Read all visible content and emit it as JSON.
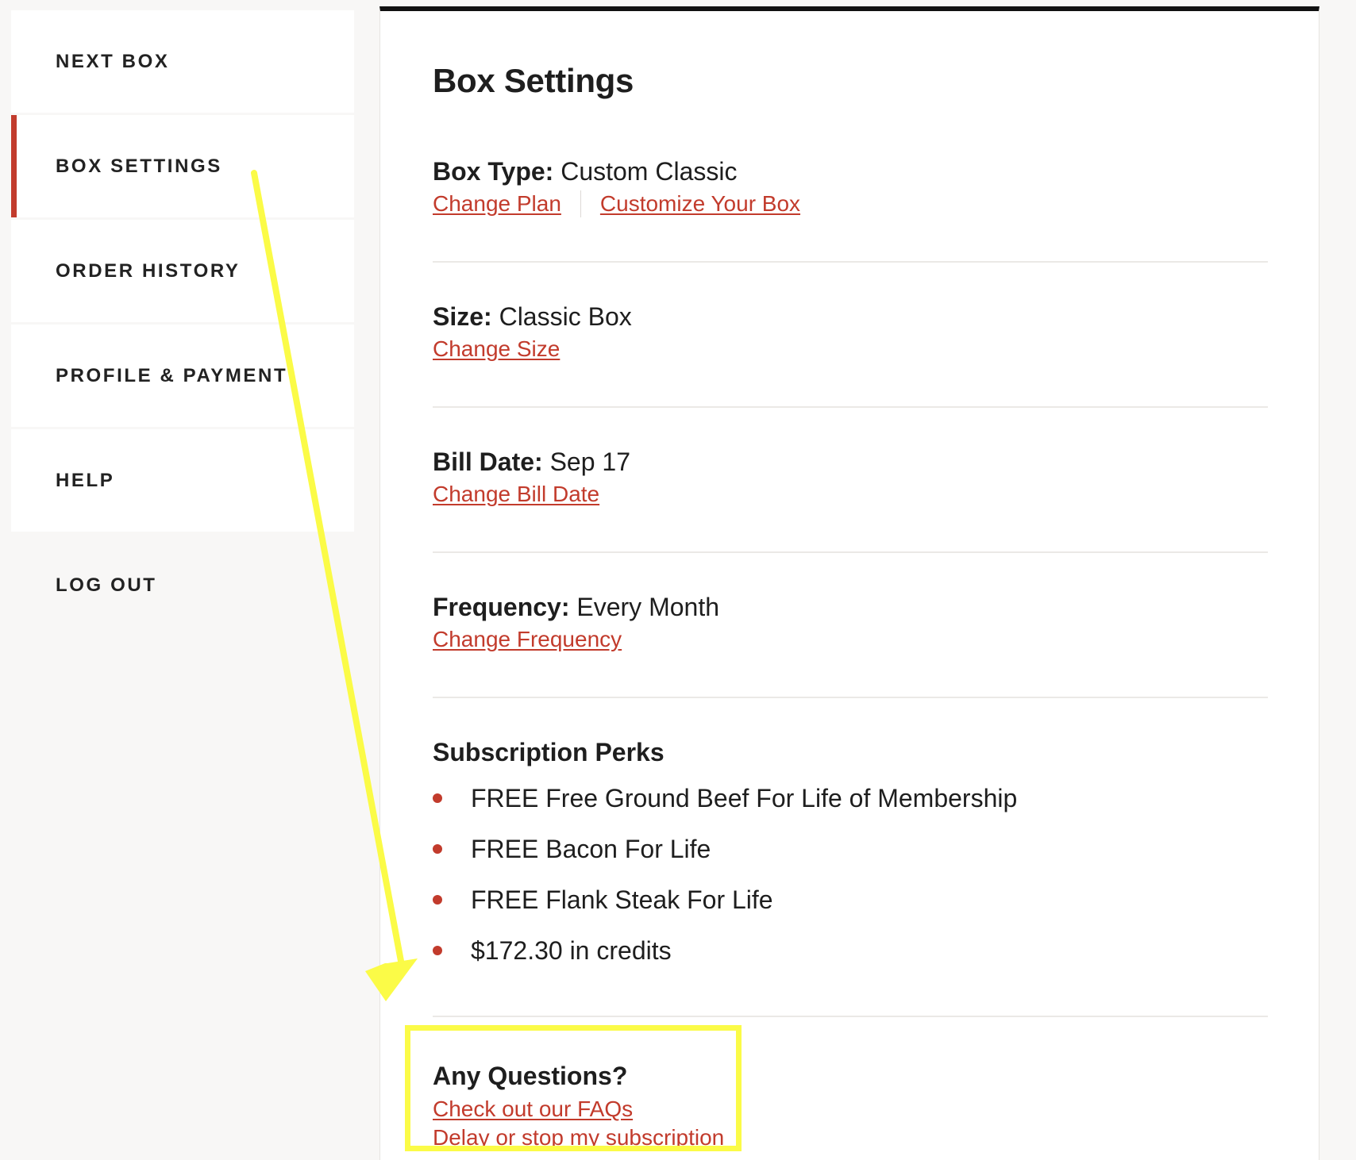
{
  "sidebar": {
    "items": [
      {
        "label": "NEXT BOX"
      },
      {
        "label": "BOX SETTINGS"
      },
      {
        "label": "ORDER HISTORY"
      },
      {
        "label": "PROFILE & PAYMENT"
      },
      {
        "label": "HELP"
      },
      {
        "label": "LOG OUT"
      }
    ],
    "active_index": 1,
    "accent_color": "#c23b2c"
  },
  "main": {
    "title": "Box Settings",
    "box_type": {
      "label": "Box Type:",
      "value": "Custom Classic",
      "links": [
        "Change Plan",
        "Customize Your Box"
      ]
    },
    "size": {
      "label": "Size:",
      "value": "Classic Box",
      "link": "Change Size"
    },
    "bill_date": {
      "label": "Bill Date:",
      "value": "Sep 17",
      "link": "Change Bill Date"
    },
    "frequency": {
      "label": "Frequency:",
      "value": "Every Month",
      "link": "Change Frequency"
    },
    "perks": {
      "title": "Subscription Perks",
      "items": [
        "FREE Free Ground Beef For Life of Membership",
        "FREE Bacon For Life",
        "FREE Flank Steak For Life",
        "$172.30 in credits"
      ]
    },
    "questions": {
      "title": "Any Questions?",
      "links": [
        "Check out our FAQs",
        "Delay or stop my subscription"
      ]
    }
  },
  "annotation": {
    "color": "#fbfb47",
    "icon": "arrow-down-icon"
  }
}
